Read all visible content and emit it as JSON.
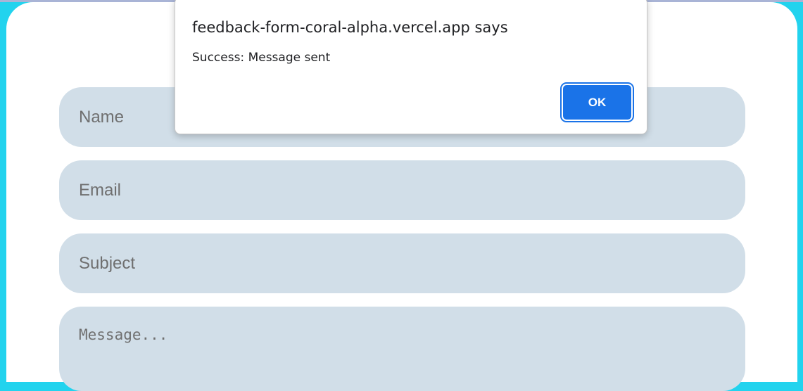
{
  "form": {
    "name_placeholder": "Name",
    "email_placeholder": "Email",
    "subject_placeholder": "Subject",
    "message_placeholder": "Message..."
  },
  "alert": {
    "title": "feedback-form-coral-alpha.vercel.app says",
    "message": "Success: Message sent",
    "ok_label": "OK"
  },
  "colors": {
    "page_background": "#22d3ee",
    "card_background": "#ffffff",
    "field_background": "#d1dee8",
    "button_blue": "#1a73e8"
  }
}
